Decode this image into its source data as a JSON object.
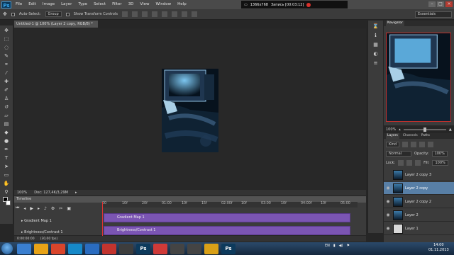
{
  "app": {
    "logo": "Ps"
  },
  "menu": [
    "File",
    "Edit",
    "Image",
    "Layer",
    "Type",
    "Select",
    "Filter",
    "3D",
    "View",
    "Window",
    "Help"
  ],
  "recorder": {
    "resolution": "1366x768",
    "status": "Запись [00:03:12]"
  },
  "options": {
    "auto_select_label": "Auto-Select:",
    "auto_select_value": "Group",
    "show_transform_label": "Show Transform Controls",
    "workspace": "Essentials"
  },
  "document": {
    "tab_title": "Untitled-1 @ 100% (Layer 2 copy, RGB/8) *",
    "zoom": "100%",
    "doc_info": "Doc: 127,4K/3,29M"
  },
  "timeline": {
    "title": "Timeline",
    "timecode": "0:00:00:00",
    "fps": "(30,00 fps)",
    "ruler": [
      "00",
      "10f",
      "20f",
      "01:00",
      "10f",
      "15f",
      "02:00f",
      "10f",
      "03:00",
      "10f",
      "04:00f",
      "10f",
      "05:00"
    ],
    "tracks": [
      {
        "row_label": "Gradient Map 1",
        "clip_label": "Gradient Map 1"
      },
      {
        "row_label": "Brightness/Contrast 1",
        "clip_label": "Brightness/Contrast 1"
      }
    ]
  },
  "panels": {
    "navigator_tab": "Navigator",
    "navigator_zoom": "100%",
    "layer_tabs": [
      "Layers",
      "Channels",
      "Paths"
    ],
    "kind": "Kind",
    "blend_mode": "Normal",
    "opacity_label": "Opacity:",
    "opacity_value": "100%",
    "lock_label": "Lock:",
    "fill_label": "Fill:",
    "fill_value": "100%",
    "layers": [
      {
        "name": "Layer 2 copy 3",
        "visible": false,
        "selected": false
      },
      {
        "name": "Layer 2 copy",
        "visible": true,
        "selected": true
      },
      {
        "name": "Layer 2 copy 2",
        "visible": true,
        "selected": false
      },
      {
        "name": "Layer 2",
        "visible": true,
        "selected": false
      },
      {
        "name": "Layer 1",
        "visible": true,
        "selected": false
      }
    ]
  },
  "taskbar": {
    "apps": [
      {
        "label": "",
        "color": "#3a7fd0",
        "icon": "ie-icon"
      },
      {
        "label": "",
        "color": "#e8a317",
        "icon": "folder-icon"
      },
      {
        "label": "",
        "color": "#d9452b",
        "icon": "chrome-icon"
      },
      {
        "label": "",
        "color": "#1689c9",
        "icon": "skype-icon"
      },
      {
        "label": "",
        "color": "#2a6cc0",
        "icon": "utorrent-icon"
      },
      {
        "label": "",
        "color": "#c2342e",
        "icon": "opera-icon"
      },
      {
        "label": "",
        "color": "#3d3d3d",
        "icon": "media-icon"
      },
      {
        "label": "Ps",
        "color": "#0d3a5c",
        "icon": "photoshop-icon"
      },
      {
        "label": "",
        "color": "#cf3a38",
        "icon": "app-icon"
      },
      {
        "label": "",
        "color": "#444",
        "icon": "app-icon"
      },
      {
        "label": "",
        "color": "#444",
        "icon": "app-icon"
      },
      {
        "label": "",
        "color": "#d9a017",
        "icon": "app-icon"
      },
      {
        "label": "Ps",
        "color": "#0d3a5c",
        "icon": "photoshop-icon"
      }
    ],
    "lang": "EN",
    "time": "14:00",
    "date": "01.11.2013"
  }
}
